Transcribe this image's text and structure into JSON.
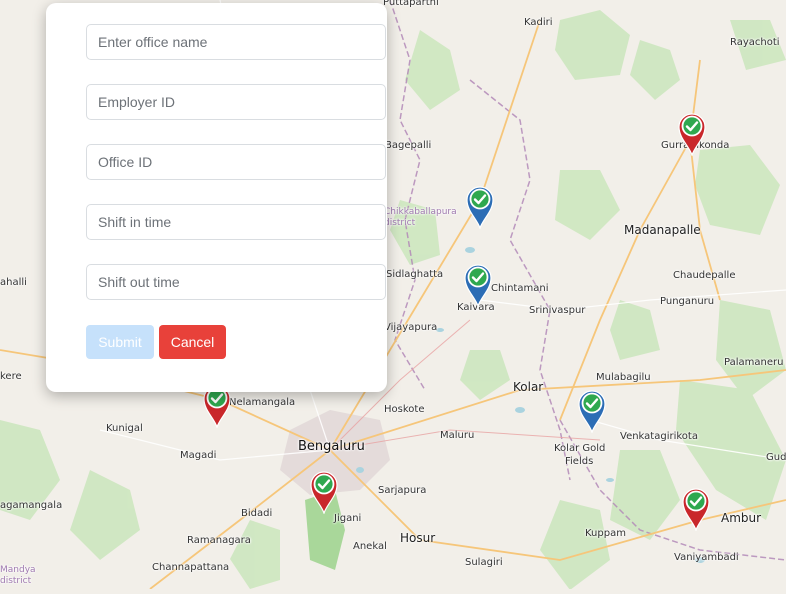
{
  "form": {
    "office_name_placeholder": "Enter office name",
    "employer_id_placeholder": "Employer ID",
    "office_id_placeholder": "Office ID",
    "shift_in_placeholder": "Shift in time",
    "shift_out_placeholder": "Shift out time",
    "submit_label": "Submit",
    "cancel_label": "Cancel",
    "submit_color": "#c6e1fb",
    "cancel_color": "#e8413a"
  },
  "map": {
    "places": {
      "puttaparthi": "Puttaparthi",
      "kadiri": "Kadiri",
      "rayachoti": "Rayachoti",
      "gurramkonda": "Gurramkonda",
      "bagepalli": "Bagepalli",
      "madanapalle": "Madanapalle",
      "chikkaballapura": "Chikkaballapura",
      "chikkaballapura_district": "district",
      "chaudepalle": "Chaudepalle",
      "chintamani": "Chintamani",
      "kaivara": "Kaivara",
      "sidlaghatta": "Sidlaghatta",
      "srinivaspur": "Srinivaspur",
      "punganuru": "Punganuru",
      "vijayapura": "Vijayapura",
      "ahalli": "ahalli",
      "palamaneru": "Palamaneru",
      "mulabagilu": "Mulabagilu",
      "kolar": "Kolar",
      "kere": "kere",
      "nelamangala": "Nelamangala",
      "hoskote": "Hoskote",
      "kunigal": "Kunigal",
      "bengaluru": "Bengaluru",
      "maluru": "Maluru",
      "venkatagirikota": "Venkatagirikota",
      "kolar_gold_fields_1": "Kolar Gold",
      "kolar_gold_fields_2": "Fields",
      "magadi": "Magadi",
      "gudiyatham": "Gud",
      "sarjapura": "Sarjapura",
      "jigani": "Jigani",
      "ambur": "Ambur",
      "nagamangala": "agamangala",
      "bidadi": "Bidadi",
      "hosur": "Hosur",
      "kuppam": "Kuppam",
      "ramanagara": "Ramanagara",
      "anekal": "Anekal",
      "vaniyambadi": "Vaniyambadi",
      "channapattana": "Channapattana",
      "sulagiri": "Sulagiri",
      "mandya": "Mandya",
      "mandya_district": "district"
    },
    "markers": [
      {
        "status": "verified",
        "color": "#c9272b",
        "check": "#2fa84f"
      },
      {
        "status": "verified",
        "color": "#2c6db5",
        "check": "#2fa84f"
      },
      {
        "status": "verified",
        "color": "#2c6db5",
        "check": "#2fa84f"
      },
      {
        "status": "verified",
        "color": "#2c6db5",
        "check": "#2fa84f"
      },
      {
        "status": "verified",
        "color": "#c9272b",
        "check": "#2fa84f"
      },
      {
        "status": "verified",
        "color": "#c9272b",
        "check": "#2fa84f"
      },
      {
        "status": "verified",
        "color": "#c9272b",
        "check": "#2fa84f"
      }
    ]
  }
}
